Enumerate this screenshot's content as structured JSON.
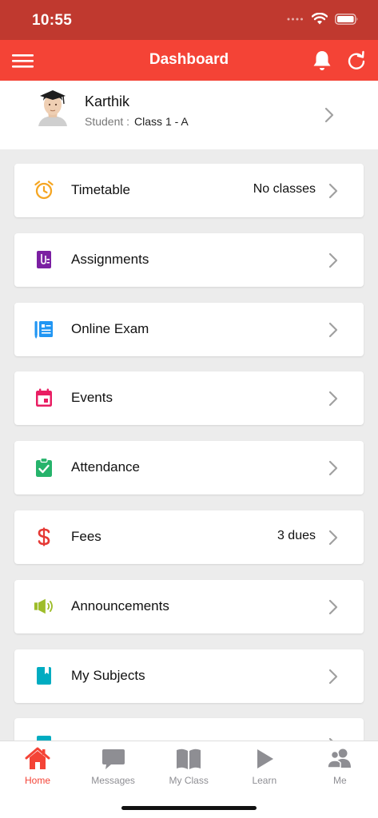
{
  "status_bar": {
    "time": "10:55"
  },
  "app_bar": {
    "title": "Dashboard"
  },
  "profile": {
    "name": "Karthik",
    "role_label": "Student :",
    "class_value": "Class 1 - A"
  },
  "menu": [
    {
      "label": "Timetable",
      "extra": "No classes",
      "icon": "alarm-clock-icon",
      "color": "#f5a623"
    },
    {
      "label": "Assignments",
      "extra": "",
      "icon": "assignment-clip-icon",
      "color": "#7b1fa2"
    },
    {
      "label": "Online Exam",
      "extra": "",
      "icon": "exam-notebook-icon",
      "color": "#2196f3"
    },
    {
      "label": "Events",
      "extra": "",
      "icon": "calendar-icon",
      "color": "#e91e63"
    },
    {
      "label": "Attendance",
      "extra": "",
      "icon": "clipboard-check-icon",
      "color": "#26b36b"
    },
    {
      "label": "Fees",
      "extra": "3 dues",
      "icon": "dollar-icon",
      "color": "#e53935"
    },
    {
      "label": "Announcements",
      "extra": "",
      "icon": "megaphone-icon",
      "color": "#9ebd2a"
    },
    {
      "label": "My Subjects",
      "extra": "",
      "icon": "book-icon",
      "color": "#00acc1"
    },
    {
      "label": "",
      "extra": "",
      "icon": "partial-item-icon",
      "color": "#00acc1"
    }
  ],
  "tabs": [
    {
      "label": "Home",
      "icon": "home-icon",
      "active": true
    },
    {
      "label": "Messages",
      "icon": "chat-bubble-icon",
      "active": false
    },
    {
      "label": "My Class",
      "icon": "open-book-icon",
      "active": false
    },
    {
      "label": "Learn",
      "icon": "play-icon",
      "active": false
    },
    {
      "label": "Me",
      "icon": "people-icon",
      "active": false
    }
  ],
  "colors": {
    "status_bar": "#c0392f",
    "app_bar": "#f44336",
    "active_tab": "#f44336",
    "inactive_tab": "#8e8e93"
  }
}
